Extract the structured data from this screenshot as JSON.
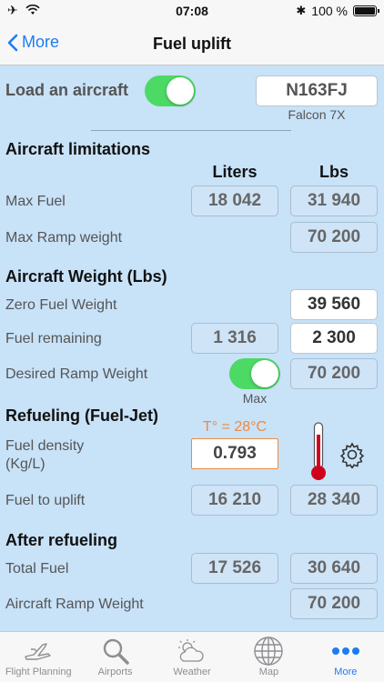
{
  "status": {
    "time": "07:08",
    "battery": "100 %"
  },
  "nav": {
    "back_label": "More",
    "title": "Fuel uplift"
  },
  "load": {
    "label": "Load an aircraft",
    "registration": "N163FJ",
    "model": "Falcon 7X"
  },
  "limitations": {
    "title": "Aircraft limitations",
    "col_liters": "Liters",
    "col_lbs": "Lbs",
    "max_fuel_label": "Max Fuel",
    "max_fuel_liters": "18 042",
    "max_fuel_lbs": "31 940",
    "max_ramp_label": "Max Ramp weight",
    "max_ramp_lbs": "70 200"
  },
  "weight": {
    "title": "Aircraft Weight (Lbs)",
    "zfw_label": "Zero Fuel Weight",
    "zfw_lbs": "39 560",
    "remaining_label": "Fuel remaining",
    "remaining_liters": "1 316",
    "remaining_lbs": "2 300",
    "desired_label": "Desired Ramp Weight",
    "desired_lbs": "70 200",
    "max_label": "Max"
  },
  "refuel": {
    "title": "Refueling (Fuel-Jet)",
    "temperature": "T° = 28°C",
    "density_label_1": "Fuel density",
    "density_label_2": "(Kg/L)",
    "density_value": "0.793",
    "uplift_label": "Fuel to uplift",
    "uplift_liters": "16 210",
    "uplift_lbs": "28 340"
  },
  "after": {
    "title": "After refueling",
    "total_label": "Total Fuel",
    "total_liters": "17 526",
    "total_lbs": "30 640",
    "ramp_label": "Aircraft Ramp Weight",
    "ramp_lbs": "70 200"
  },
  "tabs": [
    {
      "label": "Flight Planning",
      "icon": "airplane-icon"
    },
    {
      "label": "Airports",
      "icon": "magnifier-icon"
    },
    {
      "label": "Weather",
      "icon": "weather-icon"
    },
    {
      "label": "Map",
      "icon": "globe-icon"
    },
    {
      "label": "More",
      "icon": "more-icon"
    }
  ],
  "colors": {
    "accent": "#1e7cf2",
    "switch_on": "#4cd964",
    "background": "#c8e2f8",
    "warning": "#ef8a3e"
  }
}
